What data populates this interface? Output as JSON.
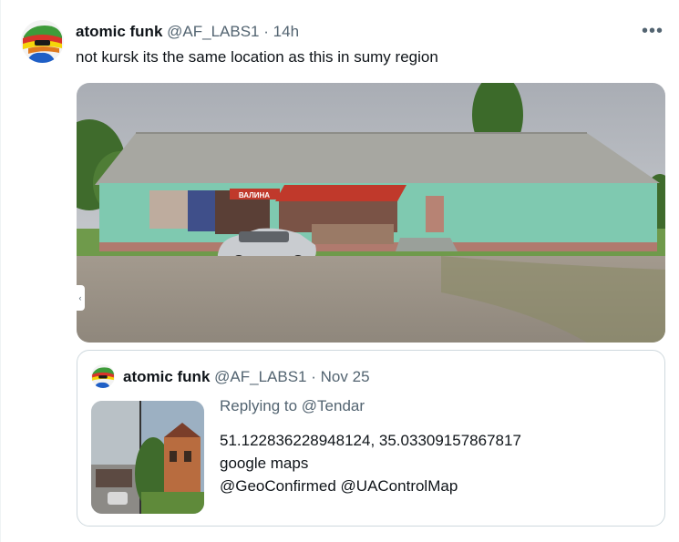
{
  "tweet": {
    "display_name": "atomic funk",
    "handle": "@AF_LABS1",
    "separator": "·",
    "time": "14h",
    "more_label": "•••",
    "text": "not kursk its the same location as this in sumy region",
    "media_sign_text": "ВАЛИНА"
  },
  "quote": {
    "display_name": "atomic funk",
    "handle": "@AF_LABS1",
    "separator": "·",
    "time": "Nov 25",
    "reply_prefix": "Replying to ",
    "reply_handle": "@Tendar",
    "lines": [
      "51.122836228948124, 35.03309157867817",
      "google maps",
      "@GeoConfirmed @UAControlMap"
    ]
  },
  "colors": {
    "text": "#0f1419",
    "muted": "#536471",
    "border": "#cfd9de",
    "building_wall": "#7fc9b0",
    "roof": "#a9a9a4",
    "awning": "#c0392b"
  }
}
